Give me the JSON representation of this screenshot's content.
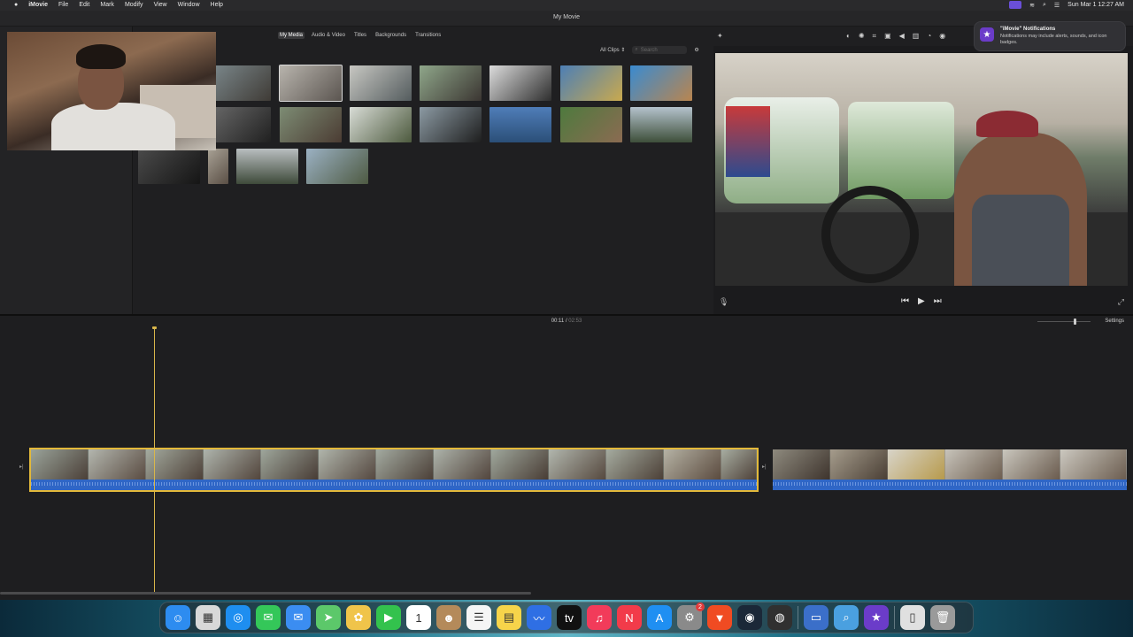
{
  "menubar": {
    "app": "iMovie",
    "items": [
      "File",
      "Edit",
      "Mark",
      "Modify",
      "View",
      "Window",
      "Help"
    ],
    "clock": "Sun Mar 1  12:27 AM"
  },
  "window": {
    "title": "My Movie"
  },
  "browser": {
    "tabs": [
      {
        "label": "My Media",
        "active": true
      },
      {
        "label": "Audio & Video",
        "active": false
      },
      {
        "label": "Titles",
        "active": false
      },
      {
        "label": "Backgrounds",
        "active": false
      },
      {
        "label": "Transitions",
        "active": false
      }
    ],
    "filter": "All Clips",
    "search_placeholder": "Search"
  },
  "viewer": {
    "tools": [
      "color-balance",
      "color-correction",
      "crop",
      "stabilization",
      "volume",
      "noise-reduction",
      "speed",
      "clip-filter"
    ]
  },
  "notification": {
    "title": "\"iMovie\" Notifications",
    "body": "Notifications may include alerts, sounds, and icon badges."
  },
  "timeline": {
    "current_time": "00:11",
    "separator": "/",
    "duration": "02:53",
    "settings_label": "Settings"
  },
  "dock": {
    "apps": [
      {
        "name": "finder",
        "glyph": "☺",
        "color": "#2d8cf0"
      },
      {
        "name": "launchpad",
        "glyph": "▦",
        "color": "#d8d8d8"
      },
      {
        "name": "safari",
        "glyph": "◎",
        "color": "#1e8ef0"
      },
      {
        "name": "messages",
        "glyph": "✉",
        "color": "#34c759"
      },
      {
        "name": "mail",
        "glyph": "✉",
        "color": "#3b8df1"
      },
      {
        "name": "maps",
        "glyph": "➤",
        "color": "#5cc86a"
      },
      {
        "name": "photos",
        "glyph": "✿",
        "color": "#f0c44a"
      },
      {
        "name": "facetime",
        "glyph": "▶",
        "color": "#33c24d"
      },
      {
        "name": "calendar",
        "glyph": "1",
        "color": "#ffffff"
      },
      {
        "name": "contacts",
        "glyph": "☻",
        "color": "#b48a5a"
      },
      {
        "name": "reminders",
        "glyph": "☰",
        "color": "#f5f5f5"
      },
      {
        "name": "notes",
        "glyph": "▤",
        "color": "#f7d44a"
      },
      {
        "name": "freeform",
        "glyph": "〰",
        "color": "#2f6fe4"
      },
      {
        "name": "apple-tv",
        "glyph": "tv",
        "color": "#111111"
      },
      {
        "name": "music",
        "glyph": "♫",
        "color": "#f23b5a"
      },
      {
        "name": "news",
        "glyph": "N",
        "color": "#f23b4a"
      },
      {
        "name": "app-store",
        "glyph": "A",
        "color": "#1f8ff2"
      },
      {
        "name": "system-settings",
        "glyph": "⚙",
        "color": "#8a8a8a",
        "badge": "2"
      },
      {
        "name": "brave",
        "glyph": "▼",
        "color": "#f04b22"
      },
      {
        "name": "steam",
        "glyph": "◉",
        "color": "#1b2838"
      },
      {
        "name": "obs",
        "glyph": "◍",
        "color": "#303030"
      }
    ],
    "recent": [
      {
        "name": "screen-sharing",
        "glyph": "▭",
        "color": "#3b6fc9"
      },
      {
        "name": "preview",
        "glyph": "⌕",
        "color": "#4aa0e0"
      },
      {
        "name": "imovie",
        "glyph": "★",
        "color": "#6b3cc9"
      }
    ],
    "extras": [
      {
        "name": "documents-folder",
        "glyph": "▯",
        "color": "#e0e0e0"
      },
      {
        "name": "trash",
        "glyph": "🗑",
        "color": "#9a9a9a"
      }
    ]
  }
}
